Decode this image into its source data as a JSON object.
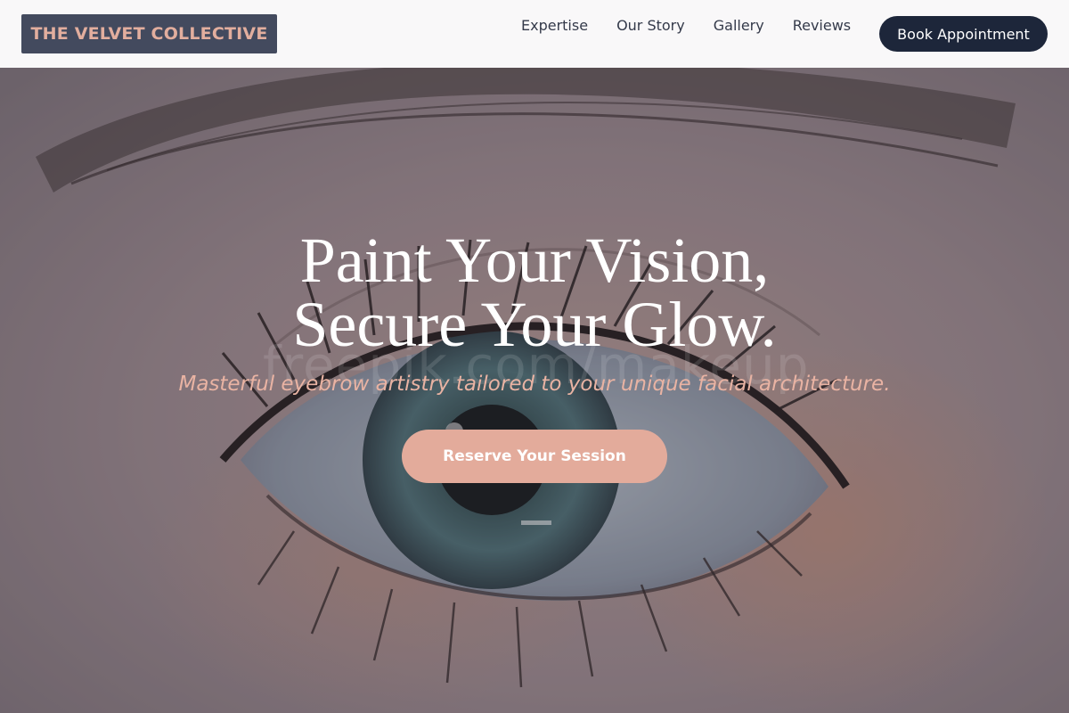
{
  "brand": {
    "name": "THE VELVET COLLECTIVE"
  },
  "nav": {
    "links": [
      {
        "label": "Expertise"
      },
      {
        "label": "Our Story"
      },
      {
        "label": "Gallery"
      },
      {
        "label": "Reviews"
      }
    ],
    "book_label": "Book Appointment"
  },
  "hero": {
    "title_line1": "Paint Your Vision,",
    "title_line2": "Secure Your Glow.",
    "subtitle": "Masterful eyebrow artistry tailored to your unique facial architecture.",
    "cta_label": "Reserve Your Session",
    "watermark": "freepik.com/makeup"
  },
  "colors": {
    "brand_bg": "#434a5e",
    "brand_text": "#e2ae9e",
    "book_bg": "#1d263a",
    "accent": "#e3ab9b",
    "subtitle": "#e9b3a3"
  }
}
